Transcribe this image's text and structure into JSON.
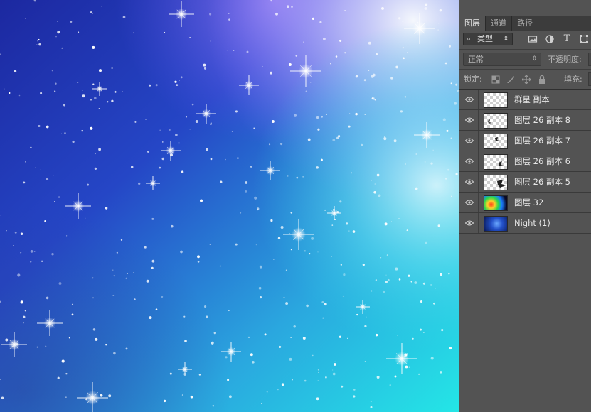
{
  "panel": {
    "tabs": [
      {
        "label": "图层",
        "active": true
      },
      {
        "label": "通道",
        "active": false
      },
      {
        "label": "路径",
        "active": false
      }
    ],
    "filter": {
      "label": "类型",
      "icons": [
        "image-filter-icon",
        "adjustment-filter-icon",
        "type-filter-icon",
        "shape-filter-icon"
      ]
    },
    "blend_mode": "正常",
    "opacity_label": "不透明度:",
    "lock_label": "锁定:",
    "lock_icons": [
      "lock-transparent-pixels-icon",
      "lock-image-pixels-icon",
      "lock-position-icon",
      "lock-all-icon"
    ],
    "fill_label": "填充:"
  },
  "layers": [
    {
      "name": "群星 副本",
      "thumb": "checker",
      "visible": true
    },
    {
      "name": "图层 26 副本 8",
      "thumb": "checker",
      "visible": true
    },
    {
      "name": "图层 26 副本 7",
      "thumb": "checker",
      "visible": true
    },
    {
      "name": "图层 26 副本 6",
      "thumb": "checker",
      "visible": true
    },
    {
      "name": "图层 26 副本 5",
      "thumb": "checker",
      "visible": true
    },
    {
      "name": "图层 32",
      "thumb": "rainbow",
      "visible": true
    },
    {
      "name": "Night (1)",
      "thumb": "night",
      "visible": true
    }
  ],
  "colors": {
    "panel_bg": "#535353",
    "tabbar_bg": "#3c3c3c",
    "canvas_deep_blue": "#1c2fa8",
    "canvas_cyan": "#2fe0e6"
  }
}
